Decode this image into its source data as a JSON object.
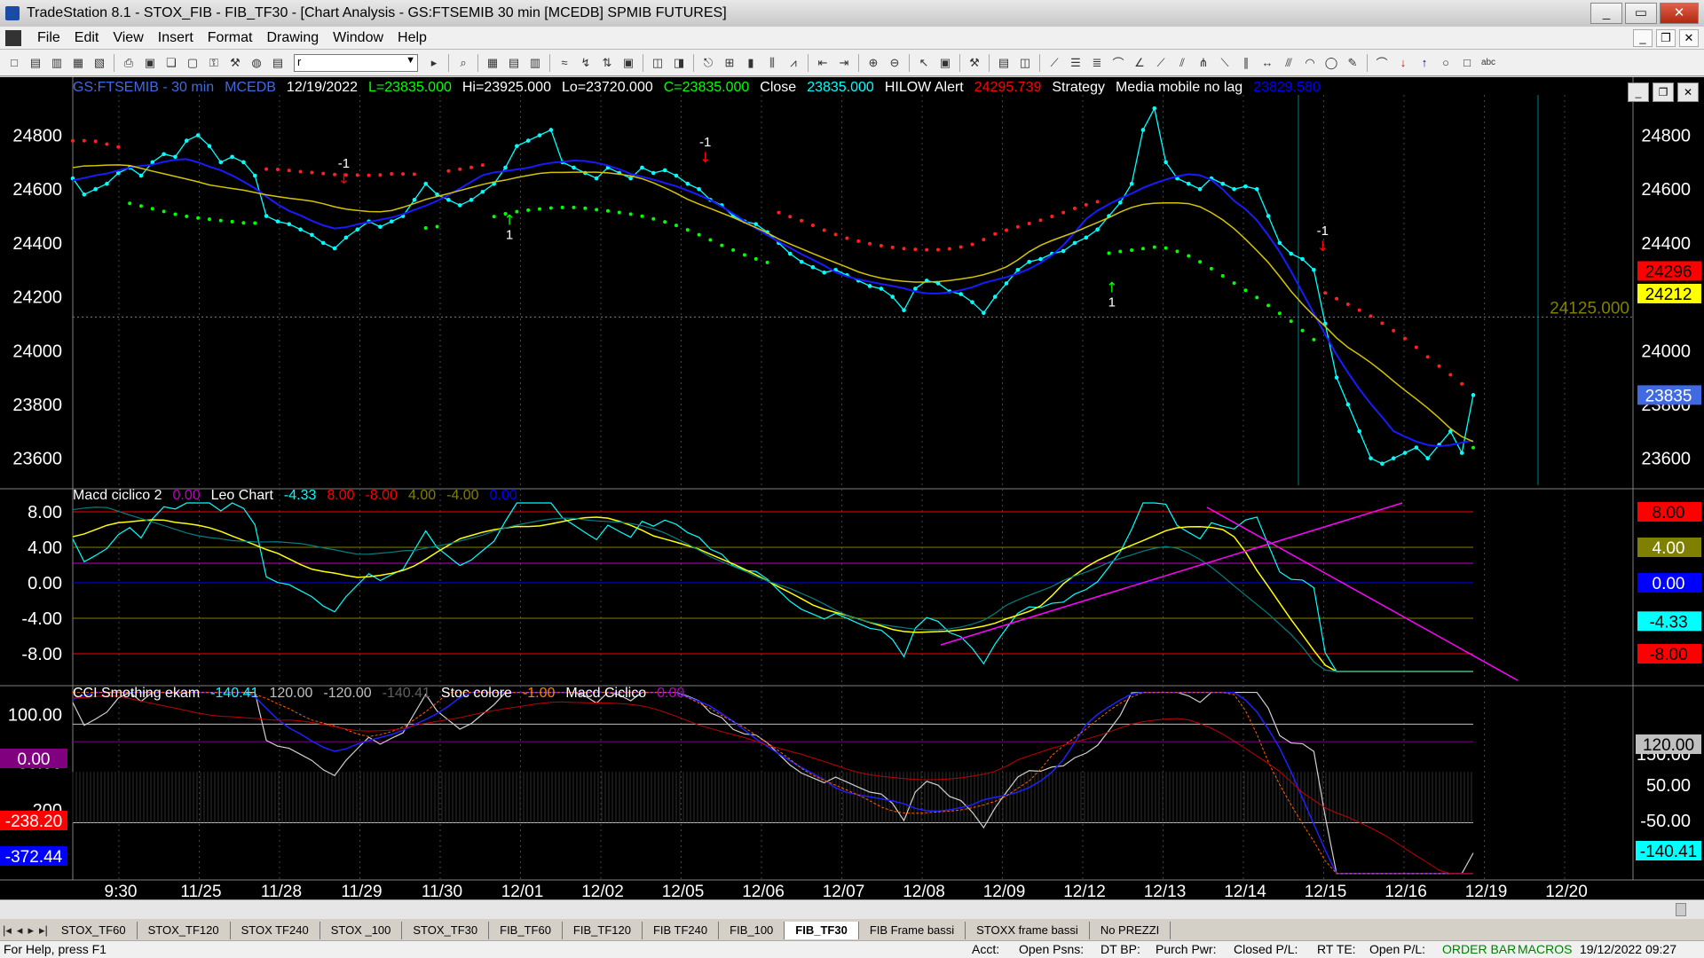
{
  "window": {
    "title": "TradeStation 8.1 - STOX_FIB - FIB_TF30 - [Chart Analysis - GS:FTSEMIB  30 min  [MCEDB] SPMIB FUTURES]",
    "min": "_",
    "max": "▭",
    "close": "✕"
  },
  "menu": [
    "File",
    "Edit",
    "View",
    "Insert",
    "Format",
    "Drawing",
    "Window",
    "Help"
  ],
  "toolbar": {
    "symbol_value": "r"
  },
  "price_panel": {
    "header": [
      {
        "text": "GS:FTSEMIB - 30 min",
        "color": "#4169e1"
      },
      {
        "text": "MCEDB",
        "color": "#4169e1"
      },
      {
        "text": "12/19/2022",
        "color": "#ffffff"
      },
      {
        "text": "L=23835.000",
        "color": "#00ff00"
      },
      {
        "text": "Hi=23925.000",
        "color": "#ffffff"
      },
      {
        "text": "Lo=23720.000",
        "color": "#ffffff"
      },
      {
        "text": "C=23835.000",
        "color": "#00ff00"
      },
      {
        "text": "Close",
        "color": "#ffffff"
      },
      {
        "text": "23835.000",
        "color": "#00ffff"
      },
      {
        "text": "HILOW Alert",
        "color": "#ffffff"
      },
      {
        "text": "24295.739",
        "color": "#ff0000"
      },
      {
        "text": "Strategy",
        "color": "#ffffff"
      },
      {
        "text": "Media mobile no lag",
        "color": "#ffffff"
      },
      {
        "text": "23829.580",
        "color": "#0000ff"
      }
    ],
    "y_labels": [
      "24800",
      "24600",
      "24400",
      "24200",
      "24000",
      "23800",
      "23600"
    ],
    "y_ticks": [
      24800,
      24600,
      24400,
      24200,
      24000,
      23800,
      23600
    ],
    "price_tags": [
      {
        "text": "24296",
        "bg": "#ff0000",
        "fg": "#000000",
        "value": 24296
      },
      {
        "text": "24212",
        "bg": "#ffff00",
        "fg": "#000000",
        "value": 24212
      },
      {
        "text": "23835",
        "bg": "#4169e1",
        "fg": "#ffffff",
        "value": 23835
      }
    ],
    "hline_label": "24125.000",
    "hline_value": 24125,
    "signals": [
      {
        "text": "-1",
        "type": "sell"
      },
      {
        "text": "1",
        "type": "buy"
      },
      {
        "text": "-1",
        "type": "sell"
      },
      {
        "text": "1",
        "type": "buy"
      },
      {
        "text": "-1",
        "type": "sell"
      }
    ]
  },
  "macd_panel": {
    "header": [
      {
        "text": "Macd ciclico 2",
        "color": "#ffffff"
      },
      {
        "text": "0.00",
        "color": "#c000c0"
      },
      {
        "text": "Leo Chart",
        "color": "#ffffff"
      },
      {
        "text": "-4.33",
        "color": "#00ffff"
      },
      {
        "text": "8.00",
        "color": "#ff0000"
      },
      {
        "text": "-8.00",
        "color": "#ff0000"
      },
      {
        "text": "4.00",
        "color": "#808000"
      },
      {
        "text": "-4.00",
        "color": "#808000"
      },
      {
        "text": "0.00",
        "color": "#0000ff"
      }
    ],
    "y_labels": [
      "8.00",
      "4.00",
      "0.00",
      "-4.00",
      "-8.00"
    ],
    "y_ticks": [
      8,
      4,
      0,
      -4,
      -8
    ],
    "tags": [
      {
        "text": "8.00",
        "bg": "#ff0000",
        "fg": "#000000",
        "value": 8
      },
      {
        "text": "4.00",
        "bg": "#808000",
        "fg": "#ffffff",
        "value": 4
      },
      {
        "text": "0.00",
        "bg": "#0000ff",
        "fg": "#ffffff",
        "value": 0
      },
      {
        "text": "-4.33",
        "bg": "#00ffff",
        "fg": "#000000",
        "value": -4.33
      },
      {
        "text": "-8.00",
        "bg": "#ff0000",
        "fg": "#000000",
        "value": -8
      }
    ]
  },
  "cci_panel": {
    "header": [
      {
        "text": "CCI Smothing ekam",
        "color": "#ffffff"
      },
      {
        "text": "-140.41",
        "color": "#00ffff"
      },
      {
        "text": "120.00",
        "color": "#c0c0c0"
      },
      {
        "text": "-120.00",
        "color": "#c0c0c0"
      },
      {
        "text": "-140.41",
        "color": "#606060"
      },
      {
        "text": "Stoc colore",
        "color": "#ffffff"
      },
      {
        "text": "-1.00",
        "color": "#ff8000"
      },
      {
        "text": "Macd Ciclico",
        "color": "#ffffff"
      },
      {
        "text": "0.00",
        "color": "#c000c0"
      }
    ],
    "y_labels": [
      "100.00",
      "-50.00",
      "-200"
    ],
    "right_labels": [
      "150.00",
      "50.00",
      "-50.00"
    ],
    "left_tags": [
      {
        "text": "0.00",
        "bg": "#800080",
        "fg": "#ffffff"
      },
      {
        "text": "-238.20",
        "bg": "#ff0000",
        "fg": "#ffffff"
      },
      {
        "text": "-372.44",
        "bg": "#0000ff",
        "fg": "#ffffff"
      }
    ],
    "right_tags": [
      {
        "text": "120.00",
        "bg": "#c0c0c0",
        "fg": "#000000"
      },
      {
        "text": "-140.41",
        "bg": "#00ffff",
        "fg": "#000000"
      }
    ]
  },
  "x_axis": [
    "9:30",
    "11/25",
    "11/28",
    "11/29",
    "11/30",
    "12/01",
    "12/02",
    "12/05",
    "12/06",
    "12/07",
    "12/08",
    "12/09",
    "12/12",
    "12/13",
    "12/14",
    "12/15",
    "12/16",
    "12/19",
    "12/20"
  ],
  "tabs": [
    "STOX_TF60",
    "STOX_TF120",
    "STOX TF240",
    "STOX _100",
    "STOX_TF30",
    "FIB_TF60",
    "FIB_TF120",
    "FIB TF240",
    "FIB_100",
    "FIB_TF30",
    "FIB Frame bassi",
    "STOXX frame bassi",
    "No PREZZI"
  ],
  "active_tab": "FIB_TF30",
  "status": {
    "help": "For Help, press F1",
    "acct": "Acct:",
    "open_psns": "Open Psns:",
    "dt_bp": "DT BP:",
    "purch_pwr": "Purch Pwr:",
    "closed_pl": "Closed P/L:",
    "rt_te": "RT TE:",
    "open_pl": "Open P/L:",
    "order_bar": "ORDER BAR",
    "macros": "MACROS",
    "datetime": "19/12/2022 09:27"
  },
  "chart_series": {
    "close": [
      24640,
      24580,
      24600,
      24620,
      24660,
      24680,
      24650,
      24700,
      24730,
      24720,
      24780,
      24800,
      24760,
      24700,
      24720,
      24700,
      24650,
      24500,
      24480,
      24470,
      24450,
      24430,
      24400,
      24380,
      24420,
      24450,
      24480,
      24460,
      24480,
      24500,
      24560,
      24620,
      24580,
      24560,
      24540,
      24560,
      24590,
      24620,
      24680,
      24760,
      24780,
      24800,
      24820,
      24700,
      24680,
      24660,
      24640,
      24680,
      24660,
      24640,
      24680,
      24660,
      24670,
      24650,
      24620,
      24600,
      24560,
      24540,
      24500,
      24480,
      24470,
      24440,
      24400,
      24360,
      24330,
      24310,
      24290,
      24300,
      24280,
      24260,
      24240,
      24230,
      24200,
      24150,
      24230,
      24260,
      24250,
      24220,
      24210,
      24180,
      24140,
      24200,
      24250,
      24300,
      24330,
      24340,
      24360,
      24370,
      24400,
      24420,
      24450,
      24500,
      24550,
      24620,
      24820,
      24900,
      24700,
      24640,
      24620,
      24600,
      24640,
      24620,
      24600,
      24610,
      24600,
      24500,
      24400,
      24360,
      24340,
      24300,
      24100,
      23900,
      23800,
      23700,
      23600,
      23580,
      23600,
      23620,
      23640,
      23600,
      23650,
      23700,
      23620,
      23835
    ]
  }
}
